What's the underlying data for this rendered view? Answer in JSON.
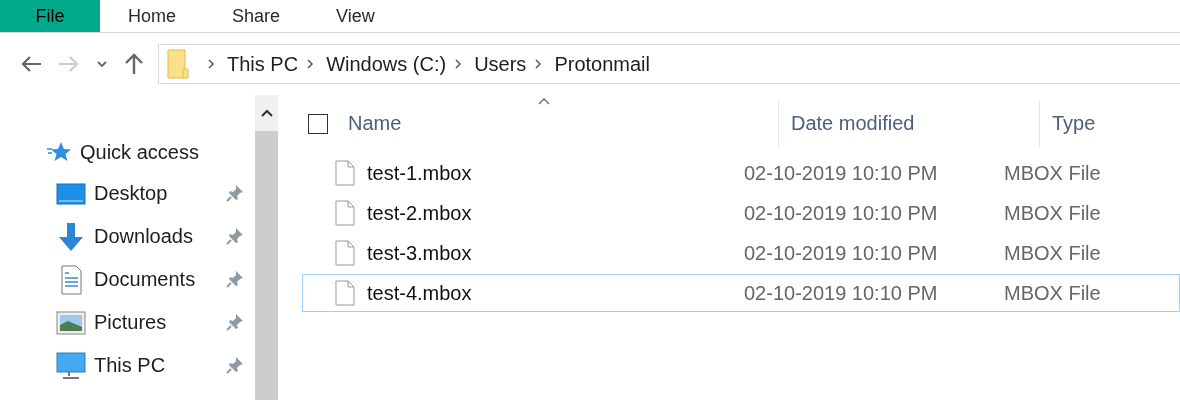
{
  "ribbon_tabs": [
    {
      "label": "File",
      "selected": true
    },
    {
      "label": "Home",
      "selected": false
    },
    {
      "label": "Share",
      "selected": false
    },
    {
      "label": "View",
      "selected": false
    }
  ],
  "nav_buttons": [
    {
      "kind": "back",
      "disabled": false
    },
    {
      "kind": "forward",
      "disabled": true
    },
    {
      "kind": "recent",
      "disabled": false
    },
    {
      "kind": "up",
      "disabled": false
    }
  ],
  "address_bar": {
    "crumbs": [
      "This PC",
      "Windows (C:)",
      "Users",
      "Protonmail"
    ]
  },
  "sidebar": {
    "items": [
      {
        "label": "Quick access",
        "kind": "star",
        "pinned": false
      },
      {
        "label": "Desktop",
        "kind": "desktop",
        "pinned": true
      },
      {
        "label": "Downloads",
        "kind": "download",
        "pinned": true
      },
      {
        "label": "Documents",
        "kind": "document",
        "pinned": true
      },
      {
        "label": "Pictures",
        "kind": "pictures",
        "pinned": true
      },
      {
        "label": "This PC",
        "kind": "monitor",
        "pinned": true
      }
    ]
  },
  "table": {
    "select_all": {
      "checked": false
    },
    "columns": [
      "Name",
      "Date modified",
      "Type"
    ],
    "rows": [
      {
        "name": "test-1.mbox",
        "date": "02-10-2019 10:10 PM",
        "type": "MBOX File",
        "focused": false
      },
      {
        "name": "test-2.mbox",
        "date": "02-10-2019 10:10 PM",
        "type": "MBOX File",
        "focused": false
      },
      {
        "name": "test-3.mbox",
        "date": "02-10-2019 10:10 PM",
        "type": "MBOX File",
        "focused": false
      },
      {
        "name": "test-4.mbox",
        "date": "02-10-2019 10:10 PM",
        "type": "MBOX File",
        "focused": true
      }
    ]
  }
}
